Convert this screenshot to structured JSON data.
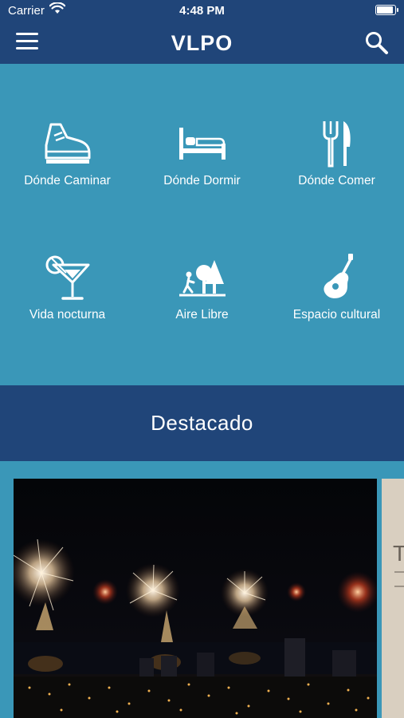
{
  "status": {
    "carrier": "Carrier",
    "time": "4:48 PM",
    "battery_level": 1.0
  },
  "navbar": {
    "title": "VLPO"
  },
  "categories": [
    {
      "label": "Dónde Caminar",
      "icon": "sneaker-icon"
    },
    {
      "label": "Dónde Dormir",
      "icon": "bed-icon"
    },
    {
      "label": "Dónde Comer",
      "icon": "fork-knife-icon"
    },
    {
      "label": "Vida nocturna",
      "icon": "cocktail-icon"
    },
    {
      "label": "Aire Libre",
      "icon": "park-icon"
    },
    {
      "label": "Espacio cultural",
      "icon": "guitar-icon"
    }
  ],
  "featured": {
    "heading": "Destacado",
    "peek_title_letter": "T"
  },
  "colors": {
    "navy": "#204579",
    "teal": "#3a97b8",
    "white": "#ffffff"
  }
}
